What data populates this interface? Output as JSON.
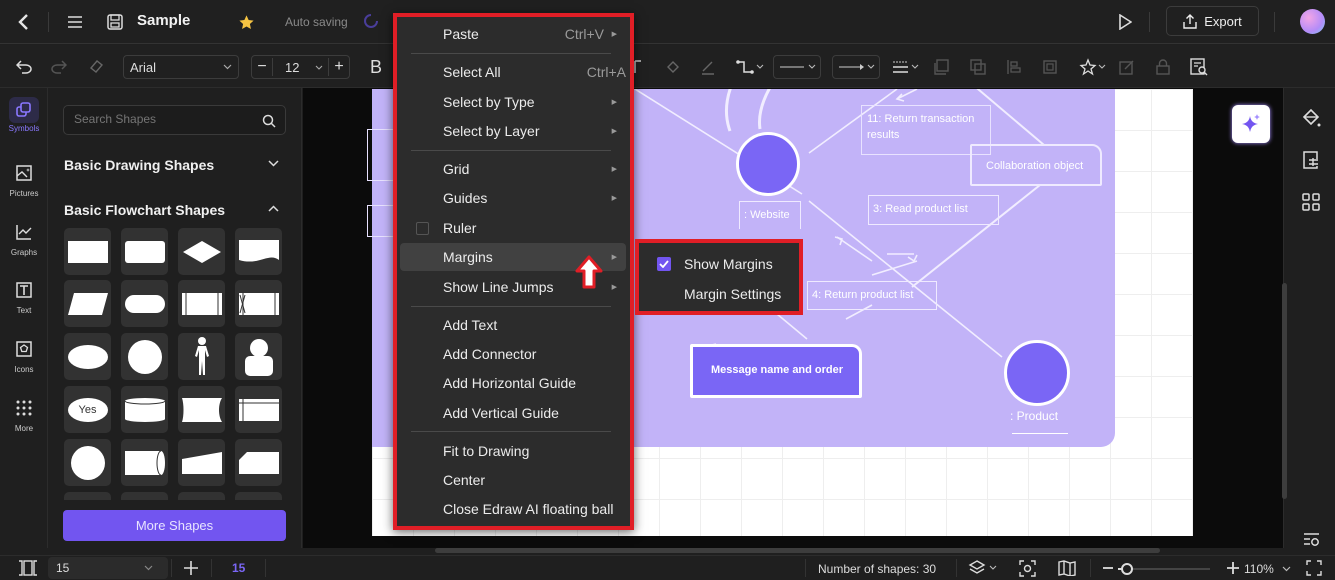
{
  "titlebar": {
    "doc_title": "Sample",
    "save_status": "Auto saving",
    "export_label": "Export"
  },
  "toolbar": {
    "font_family": "Arial",
    "font_size": "12",
    "bold_label": "B"
  },
  "rail": {
    "items": [
      {
        "label": "Symbols",
        "icon": "symbols-icon",
        "active": true
      },
      {
        "label": "Pictures",
        "icon": "picture-icon"
      },
      {
        "label": "Graphs",
        "icon": "graph-icon"
      },
      {
        "label": "Text",
        "icon": "text-icon"
      },
      {
        "label": "Icons",
        "icon": "icons-icon"
      },
      {
        "label": "More",
        "icon": "more-grid-icon"
      }
    ]
  },
  "panel": {
    "search_placeholder": "Search Shapes",
    "sections": [
      {
        "title": "Basic Drawing Shapes",
        "expanded": false
      },
      {
        "title": "Basic Flowchart Shapes",
        "expanded": true
      }
    ],
    "shape_yes_label": "Yes",
    "more_shapes_label": "More Shapes"
  },
  "context_menu": {
    "items": [
      {
        "label": "Paste",
        "shortcut": "Ctrl+V",
        "submenu": true
      },
      {
        "label": "Select All",
        "shortcut": "Ctrl+A",
        "submenu": false
      },
      {
        "label": "Select by Type",
        "submenu": true
      },
      {
        "label": "Select by Layer",
        "submenu": true
      },
      {
        "label": "Grid",
        "submenu": true
      },
      {
        "label": "Guides",
        "submenu": true
      },
      {
        "label": "Ruler",
        "checkbox": true,
        "checked": false
      },
      {
        "label": "Margins",
        "submenu": true,
        "highlighted": true
      },
      {
        "label": "Show Line Jumps",
        "submenu": true
      },
      {
        "label": "Add Text"
      },
      {
        "label": "Add Connector"
      },
      {
        "label": "Add Horizontal Guide"
      },
      {
        "label": "Add Vertical Guide"
      },
      {
        "label": "Fit to Drawing"
      },
      {
        "label": "Center"
      },
      {
        "label": "Close Edraw AI floating ball"
      }
    ],
    "submenu": [
      {
        "label": "Show Margins",
        "checked": true
      },
      {
        "label": "Margin Settings"
      }
    ]
  },
  "diagram": {
    "labels": {
      "return_transaction": "11: Return transaction results",
      "collaboration": "Collaboration object",
      "website": ": Website",
      "read_product": "3: Read product list",
      "return_product": "4: Return product list",
      "message": "Message name and order",
      "product": ": Product"
    }
  },
  "statusbar": {
    "page_select": "15",
    "page_count": "15",
    "shapes_count": "Number of shapes: 30",
    "zoom": "110%",
    "zoom_fraction": 0.1
  },
  "colors": {
    "accent": "#7255f0",
    "highlight_border": "#e01e26",
    "diagram_bg": "#c2b3f8",
    "node_fill": "#7a66f5"
  }
}
